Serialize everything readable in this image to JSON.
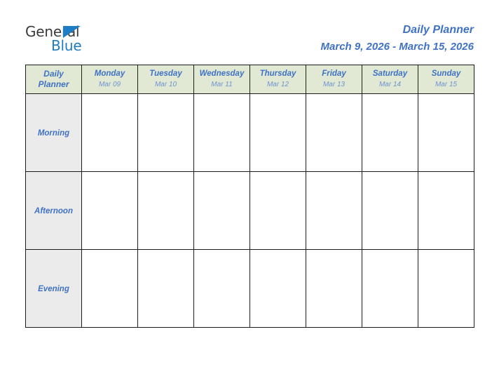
{
  "brand": {
    "name_part1": "General",
    "name_part2": "Blue",
    "triangle_icon": "triangle-icon",
    "color_dark": "#3b3b3b",
    "color_blue": "#1f7dc4"
  },
  "header": {
    "title": "Daily Planner",
    "date_range": "March 9, 2026 - March 15, 2026",
    "title_color": "#3f72c4"
  },
  "table": {
    "corner_label_line1": "Daily",
    "corner_label_line2": "Planner",
    "header_bg": "#e1e9d5",
    "label_bg": "#ebebeb",
    "border_color": "#1c1c1c",
    "columns": [
      {
        "day": "Monday",
        "date": "Mar 09"
      },
      {
        "day": "Tuesday",
        "date": "Mar 10"
      },
      {
        "day": "Wednesday",
        "date": "Mar 11"
      },
      {
        "day": "Thursday",
        "date": "Mar 12"
      },
      {
        "day": "Friday",
        "date": "Mar 13"
      },
      {
        "day": "Saturday",
        "date": "Mar 14"
      },
      {
        "day": "Sunday",
        "date": "Mar 15"
      }
    ],
    "rows": [
      {
        "label": "Morning",
        "cells": [
          "",
          "",
          "",
          "",
          "",
          "",
          ""
        ]
      },
      {
        "label": "Afternoon",
        "cells": [
          "",
          "",
          "",
          "",
          "",
          "",
          ""
        ]
      },
      {
        "label": "Evening",
        "cells": [
          "",
          "",
          "",
          "",
          "",
          "",
          ""
        ]
      }
    ]
  }
}
